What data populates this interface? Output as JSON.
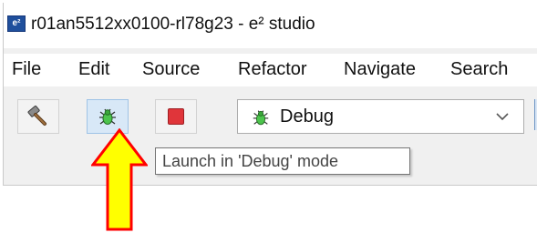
{
  "window": {
    "app_icon_text": "e²",
    "title": "r01an5512xx0100-rl78g23 - e² studio"
  },
  "menu": {
    "items": [
      "File",
      "Edit",
      "Source",
      "Refactor",
      "Navigate",
      "Search"
    ]
  },
  "toolbar": {
    "build_icon": "hammer-icon",
    "debug_icon": "bug-icon",
    "terminate_icon": "stop-icon",
    "launch_config_value": "Debug",
    "launch_config_icon": "bug-icon"
  },
  "tooltip": {
    "text": "Launch in 'Debug' mode"
  },
  "annotation": {
    "arrow_color": "#ffff00",
    "arrow_outline": "#ff0000"
  }
}
